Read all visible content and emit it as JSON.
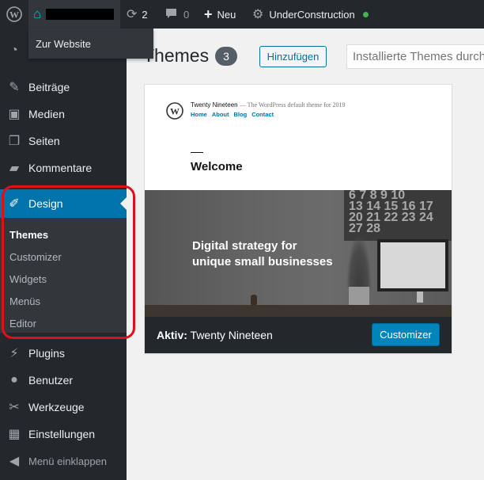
{
  "adminbar": {
    "site_menu_item": "Zur Website",
    "updates_count": "2",
    "comments_count": "0",
    "new_label": "Neu",
    "site_name": "UnderConstruction"
  },
  "sidebar": {
    "items": [
      {
        "label": "Beiträge",
        "icon": "pin-icon"
      },
      {
        "label": "Medien",
        "icon": "media-icon"
      },
      {
        "label": "Seiten",
        "icon": "pages-icon"
      },
      {
        "label": "Kommentare",
        "icon": "comment-icon"
      },
      {
        "label": "Design",
        "icon": "brush-icon"
      },
      {
        "label": "Plugins",
        "icon": "plugin-icon"
      },
      {
        "label": "Benutzer",
        "icon": "user-icon"
      },
      {
        "label": "Werkzeuge",
        "icon": "wrench-icon"
      },
      {
        "label": "Einstellungen",
        "icon": "settings-icon"
      },
      {
        "label": "Menü einklappen",
        "icon": "collapse-icon"
      }
    ],
    "design_submenu": [
      "Themes",
      "Customizer",
      "Widgets",
      "Menüs",
      "Editor"
    ]
  },
  "header": {
    "title": "Themes",
    "count": "3",
    "add_button": "Hinzufügen",
    "search_placeholder": "Installierte Themes durchsuchen..."
  },
  "theme_card": {
    "preview": {
      "site_title": "Twenty Nineteen",
      "site_description": "— The WordPress default theme for 2019",
      "nav": [
        "Home",
        "About",
        "Blog",
        "Contact"
      ],
      "welcome": "Welcome",
      "hero_line1": "Digital strategy for",
      "hero_line2": "unique small businesses",
      "calendar_rows": [
        "6 7 8 9 10",
        "13 14 15 16 17",
        "20 21 22 23 24",
        "27 28"
      ]
    },
    "active_prefix": "Aktiv:",
    "active_name": "Twenty Nineteen",
    "customizer_button": "Customizer"
  },
  "colors": {
    "adminbar_bg": "#23282d",
    "accent": "#0073aa",
    "button_primary": "#0085ba",
    "highlight_border": "#e0101a",
    "status_dot": "#46b450"
  }
}
